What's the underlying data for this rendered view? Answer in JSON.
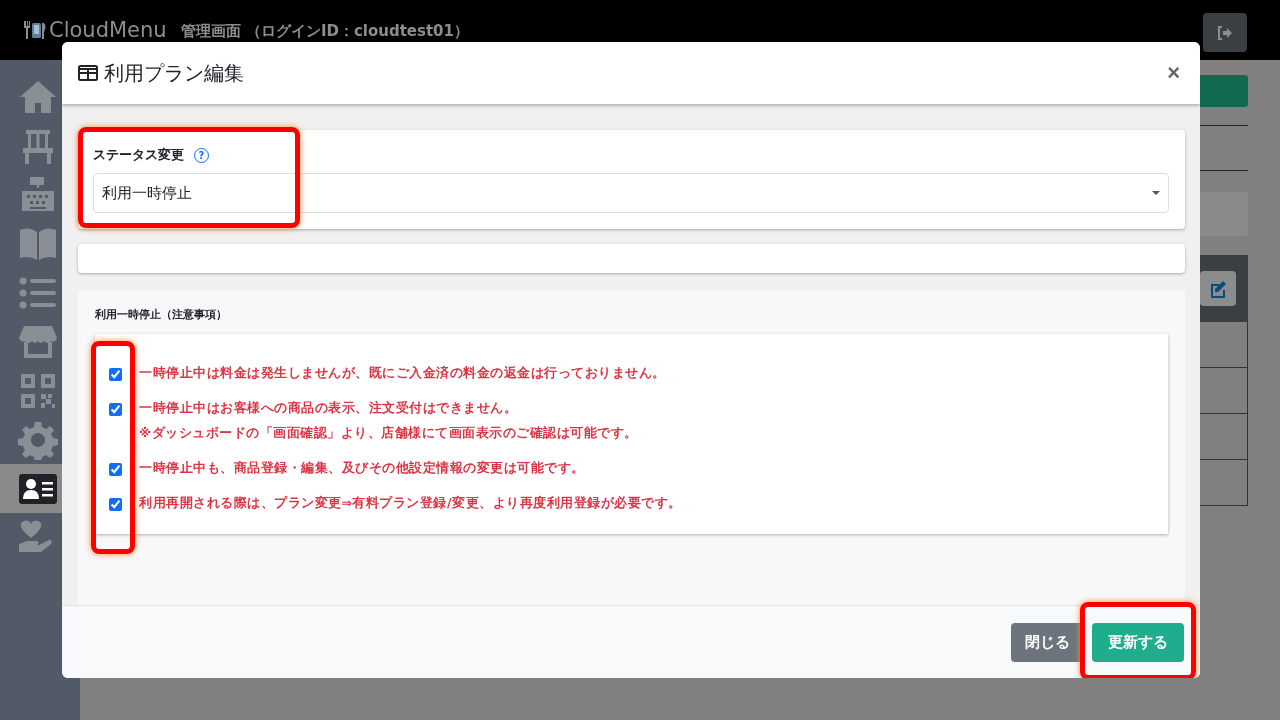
{
  "header": {
    "logo": "CloudMenu",
    "title": "管理画面 （ログインID：cloudtest01）"
  },
  "sidebar": {
    "items": [
      {
        "kind": "home",
        "selected": false
      },
      {
        "kind": "chair",
        "selected": false
      },
      {
        "kind": "register",
        "selected": false
      },
      {
        "kind": "book",
        "selected": false
      },
      {
        "kind": "list",
        "selected": false
      },
      {
        "kind": "store",
        "selected": false
      },
      {
        "kind": "qr",
        "selected": false
      },
      {
        "kind": "gear",
        "selected": false
      },
      {
        "kind": "account",
        "selected": true
      },
      {
        "kind": "heart",
        "selected": false
      }
    ]
  },
  "modal": {
    "title": "利用プラン編集",
    "close": "×",
    "status": {
      "label": "ステータス変更",
      "help": "?",
      "value": "利用一時停止"
    },
    "notes": {
      "heading": "利用一時停止（注意事項）",
      "items": [
        {
          "checked": true,
          "lines": [
            "一時停止中は料金は発生しませんが、既にご入金済の料金の返金は行っておりません。"
          ]
        },
        {
          "checked": true,
          "lines": [
            "一時停止中はお客様への商品の表示、注文受付はできません。",
            "※ダッシュボードの「画面確認」より、店舗様にて画面表示のご確認は可能です。"
          ]
        },
        {
          "checked": true,
          "lines": [
            "一時停止中も、商品登録・編集、及びその他設定情報の変更は可能です。"
          ]
        },
        {
          "checked": true,
          "lines": [
            "利用再開される際は、プラン変更⇒有料プラン登録/変更、より再度利用登録が必要です。"
          ]
        }
      ]
    },
    "buttons": [
      {
        "label": "閉じる",
        "kind": "secondary"
      },
      {
        "label": "更新する",
        "kind": "primary"
      }
    ]
  }
}
